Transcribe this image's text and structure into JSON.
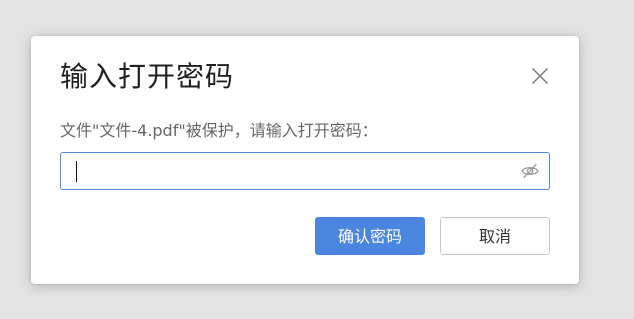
{
  "dialog": {
    "title": "输入打开密码",
    "prompt": "文件\"文件-4.pdf\"被保护，请输入打开密码：",
    "password_field": {
      "value": "",
      "placeholder": ""
    },
    "confirm_label": "确认密码",
    "cancel_label": "取消",
    "close_icon": "close-icon",
    "visibility_icon": "eye-hidden-icon"
  },
  "colors": {
    "primary": "#4a86df",
    "field_border": "#4f8bd6",
    "backdrop": "#e3e3e3"
  }
}
